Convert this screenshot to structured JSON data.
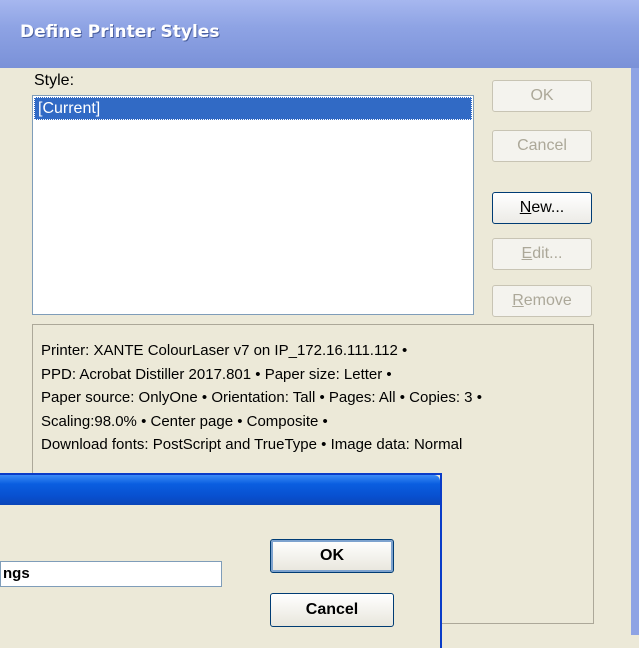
{
  "window": {
    "title": "Define Printer Styles"
  },
  "style_label": "Style:",
  "styles": [
    "[Current]"
  ],
  "buttons": {
    "ok": "OK",
    "cancel": "Cancel",
    "new_pre": "",
    "new_u": "N",
    "new_post": "ew...",
    "edit_pre": "",
    "edit_u": "E",
    "edit_post": "dit...",
    "remove_pre": "",
    "remove_u": "R",
    "remove_post": "emove"
  },
  "info_lines": [
    "Printer: XANTE ColourLaser v7 on IP_172.16.111.112 •",
    "PPD: Acrobat Distiller 2017.801 • Paper size: Letter •",
    "Paper source: OnlyOne • Orientation: Tall • Pages: All • Copies: 3 •",
    "Scaling:98.0% • Center page • Composite •",
    "Download fonts: PostScript and TrueType • Image data: Normal"
  ],
  "sub_dialog": {
    "name_value": "ngs",
    "ok": "OK",
    "cancel": "Cancel"
  }
}
